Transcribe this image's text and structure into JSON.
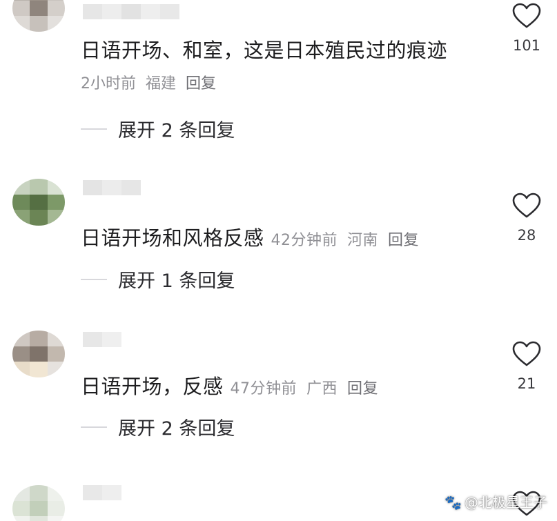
{
  "comments": [
    {
      "text": "日语开场、和室，这是日本殖民过的痕迹",
      "time": "2小时前",
      "location": "福建",
      "reply_label": "回复",
      "expand_label": "展开 2 条回复",
      "like_count": "101"
    },
    {
      "text": "日语开场和风格反感",
      "time": "42分钟前",
      "location": "河南",
      "reply_label": "回复",
      "expand_label": "展开 1 条回复",
      "like_count": "28"
    },
    {
      "text": "日语开场，反感",
      "time": "47分钟前",
      "location": "广西",
      "reply_label": "回复",
      "expand_label": "展开 2 条回复",
      "like_count": "21"
    }
  ],
  "watermark": {
    "icon": "paw-icon",
    "text": "@北极星王子"
  },
  "colors": {
    "text": "#1d1d1f",
    "meta": "#8f8f94",
    "dash": "#d8d8dc",
    "heart": "#2a2a2e"
  }
}
